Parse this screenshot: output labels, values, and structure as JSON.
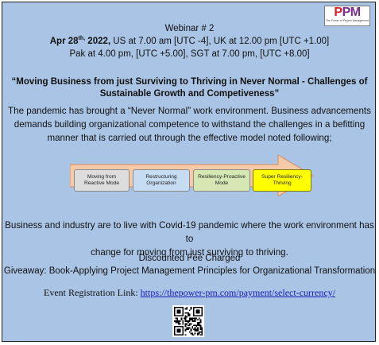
{
  "logo": {
    "text_part1": "P",
    "text_part2": "PM",
    "tagline": "The Power of Project Management"
  },
  "header": {
    "webinar": "Webinar # 2",
    "date_main": "Apr 28",
    "date_sup": "th,",
    "date_year": " 2022,",
    "times_line1": " US at 7.00 am [UTC -4], UK at 12.00 pm [UTC +1.00]",
    "times_line2": "Pak at 4.00 pm, [UTC +5.00], SGT at 7.00 pm, [UTC +8.00]"
  },
  "title": {
    "line1": "“Moving Business from just Surviving to Thriving in Never Normal - Challenges of",
    "line2": "Sustainable Growth and Competiveness”"
  },
  "intro": {
    "line1": "The pandemic has brought a “Never Normal” work environment. Business advancements",
    "line2": "demands building organizational competence to withstand the challenges in a befitting",
    "line3": "manner that is carried out through the effective model noted following;"
  },
  "model": {
    "steps": [
      {
        "line1": "Moving from",
        "line2": "Reactive Mode"
      },
      {
        "line1": "Restructuring",
        "line2": "Organization"
      },
      {
        "line1": "Resiliency-Proactive",
        "line2": "Mode"
      },
      {
        "line1": "Super Resiliency-",
        "line2": "Thriving"
      }
    ],
    "colors": {
      "arrow": "#f6c9a8",
      "arrow_border": "#d98a5a"
    }
  },
  "closing": {
    "line1": "Business and industry are to live with Covid-19 pandemic where the work environment has to",
    "line2": "change for moving from just surviving to thriving."
  },
  "offer": {
    "fee": "Discounted Fee Charged",
    "giveaway": "Giveaway: Book-Applying Project Management Principles for Organizational Transformation"
  },
  "registration": {
    "label": "Event Registration Link: ",
    "url": "https://thepower-pm.com/payment/select-currency/"
  },
  "qr": {
    "icon": "qr-code-icon"
  }
}
